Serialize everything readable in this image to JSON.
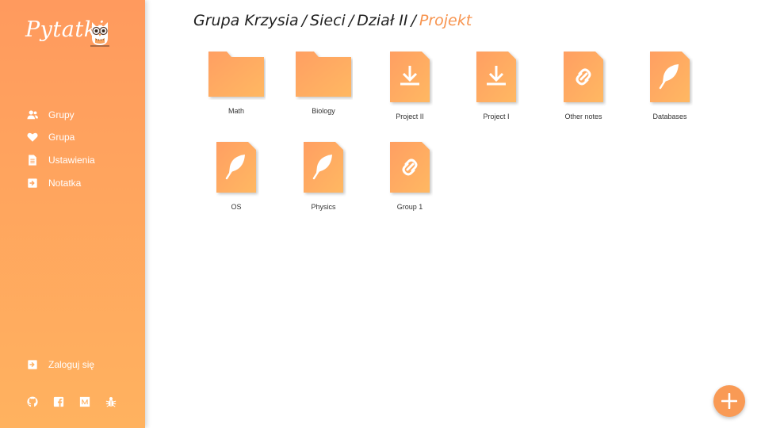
{
  "app": {
    "logo_text": "Pytatki"
  },
  "sidebar": {
    "items": [
      {
        "label": "Grupy",
        "icon": "users-icon"
      },
      {
        "label": "Grupa",
        "icon": "heart-icon"
      },
      {
        "label": "Ustawienia",
        "icon": "document-icon"
      },
      {
        "label": "Notatka",
        "icon": "sign-in-icon"
      }
    ],
    "login": {
      "label": "Zaloguj się",
      "icon": "sign-in-icon"
    },
    "social": [
      "github-icon",
      "facebook-icon",
      "medium-icon",
      "bug-icon"
    ]
  },
  "breadcrumb": {
    "items": [
      "Grupa Krzysia",
      "Sieci",
      "Dział II"
    ],
    "current": "Projekt"
  },
  "items": [
    {
      "label": "Math",
      "type": "folder",
      "icon": "folder-icon"
    },
    {
      "label": "Biology",
      "type": "folder",
      "icon": "folder-icon"
    },
    {
      "label": "Project II",
      "type": "file",
      "icon": "download-icon"
    },
    {
      "label": "Project I",
      "type": "file",
      "icon": "download-icon"
    },
    {
      "label": "Other notes",
      "type": "link",
      "icon": "link-icon"
    },
    {
      "label": "Databases",
      "type": "note",
      "icon": "feather-icon"
    },
    {
      "label": "OS",
      "type": "note",
      "icon": "feather-icon"
    },
    {
      "label": "Physics",
      "type": "note",
      "icon": "feather-icon"
    },
    {
      "label": "Group 1",
      "type": "link",
      "icon": "link-icon"
    }
  ],
  "colors": {
    "accent": "#f7944f",
    "sidebar_top": "#ff9a5e",
    "sidebar_bottom": "#ffb25f"
  },
  "fab": {
    "icon": "plus-icon"
  }
}
